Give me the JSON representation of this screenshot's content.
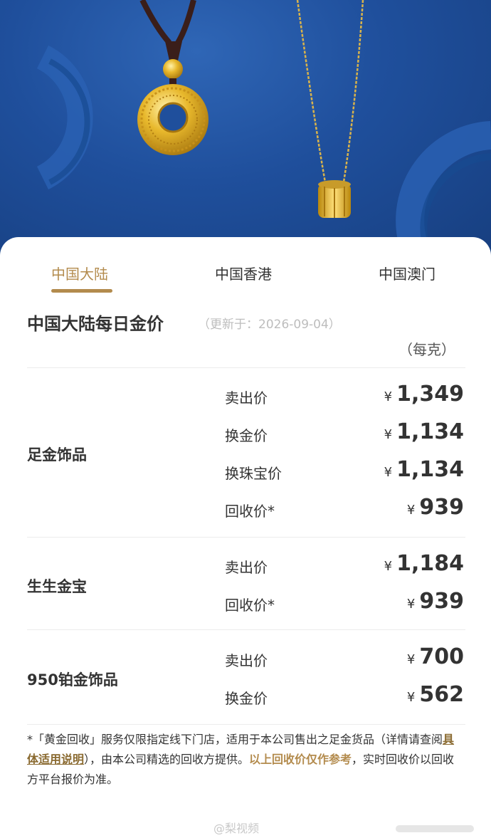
{
  "tabs": [
    {
      "label": "中国大陆",
      "active": true
    },
    {
      "label": "中国香港",
      "active": false
    },
    {
      "label": "中国澳门",
      "active": false
    }
  ],
  "title": "中国大陆每日金价",
  "updated": "（更新于：2026-09-04）",
  "unit": "（每克）",
  "currency_symbol": "¥",
  "categories": [
    {
      "name": "足金饰品",
      "prices": [
        {
          "label": "卖出价",
          "value": "1,349"
        },
        {
          "label": "换金价",
          "value": "1,134"
        },
        {
          "label": "换珠宝价",
          "value": "1,134"
        },
        {
          "label": "回收价*",
          "value": "939"
        }
      ]
    },
    {
      "name": "生生金宝",
      "prices": [
        {
          "label": "卖出价",
          "value": "1,184"
        },
        {
          "label": "回收价*",
          "value": "939"
        }
      ]
    },
    {
      "name": "950铂金饰品",
      "prices": [
        {
          "label": "卖出价",
          "value": "700"
        },
        {
          "label": "换金价",
          "value": "562"
        }
      ]
    }
  ],
  "note": {
    "part1": "*「黄金回收」服务仅限指定线下门店，适用于本公司售出之足金货品（详情请查阅",
    "link": "具体适用说明",
    "part2": "），由本公司精选的回收方提供。",
    "highlight": "以上回收价仅作参考",
    "part3": "，实时回收价以回收方平台报价为准。"
  },
  "watermark": "@梨视频",
  "colors": {
    "accent": "#b38b4d",
    "hero_blue": "#1f4f9c",
    "text": "#333333"
  }
}
